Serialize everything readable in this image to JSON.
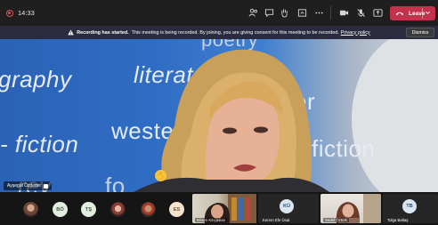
{
  "topbar": {
    "timer": "14:33",
    "icons": [
      "people-icon",
      "chat-icon",
      "raise-hand-icon",
      "share-tray-icon",
      "more-actions-icon",
      "camera-icon",
      "microphone-muted-icon",
      "share-icon"
    ],
    "leave_label": "Leave",
    "leave_color": "#c4314b"
  },
  "banner": {
    "title": "Recording has started.",
    "message": "This meeting is being recorded. By joining, you are giving consent for this meeting to be recorded.",
    "policy_link": "Privacy policy",
    "dismiss_label": "Dismiss",
    "background": "#2b2b40"
  },
  "main_video": {
    "speaker_name": "Ayşegül Özdemir",
    "background_words": [
      "poetry",
      "literature",
      "graphy",
      "wester",
      "er",
      "- fiction",
      "fiction",
      "rey",
      "fo"
    ]
  },
  "gallery": {
    "participants": [
      {
        "type": "photo"
      },
      {
        "type": "initials",
        "initials": "BÖ"
      },
      {
        "type": "initials",
        "initials": "TŞ"
      },
      {
        "type": "photo"
      },
      {
        "type": "photo"
      },
      {
        "type": "initials",
        "initials": "ES"
      },
      {
        "type": "video",
        "name": "Birsen Kılıçaslan"
      },
      {
        "type": "initials",
        "initials": "KÜ",
        "name": "Kerem Efe Ünal"
      },
      {
        "type": "video",
        "name": "Sedef Öztürk"
      },
      {
        "type": "initials",
        "initials": "TB",
        "name": "Tolga Baltaş"
      }
    ]
  }
}
